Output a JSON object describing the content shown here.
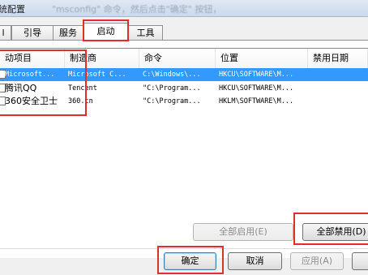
{
  "window": {
    "title": "统配置",
    "title_hint": "\"msconfig\" 命令，然后点击\"确定\" 按钮，"
  },
  "tabs": [
    {
      "label": "l"
    },
    {
      "label": "引导"
    },
    {
      "label": "服务"
    },
    {
      "label": "启动"
    },
    {
      "label": "工具"
    }
  ],
  "columns": [
    "动项目",
    "制造商",
    "命令",
    "位置",
    "禁用日期"
  ],
  "rows": [
    {
      "item": "Microsoft...",
      "maker": "Microsoft C...",
      "command": "C:\\Windows\\...",
      "location": "HKCU\\SOFTWARE\\M...",
      "date": ""
    },
    {
      "item": "腾讯QQ",
      "maker": "Tencent",
      "command": "\"C:\\Program...",
      "location": "HKCU\\SOFTWARE\\M...",
      "date": ""
    },
    {
      "item": "360安全卫士",
      "maker": "360.cn",
      "command": "\"C:\\Program...",
      "location": "HKLM\\SOFTWARE\\M...",
      "date": ""
    }
  ],
  "buttons": {
    "enable_all": "全部启用(E)",
    "disable_all": "全部禁用(D)",
    "ok": "确定",
    "cancel": "取消",
    "apply": "应用(A)"
  },
  "colors": {
    "highlight": "#e32c2c",
    "selection": "#3399ff"
  }
}
